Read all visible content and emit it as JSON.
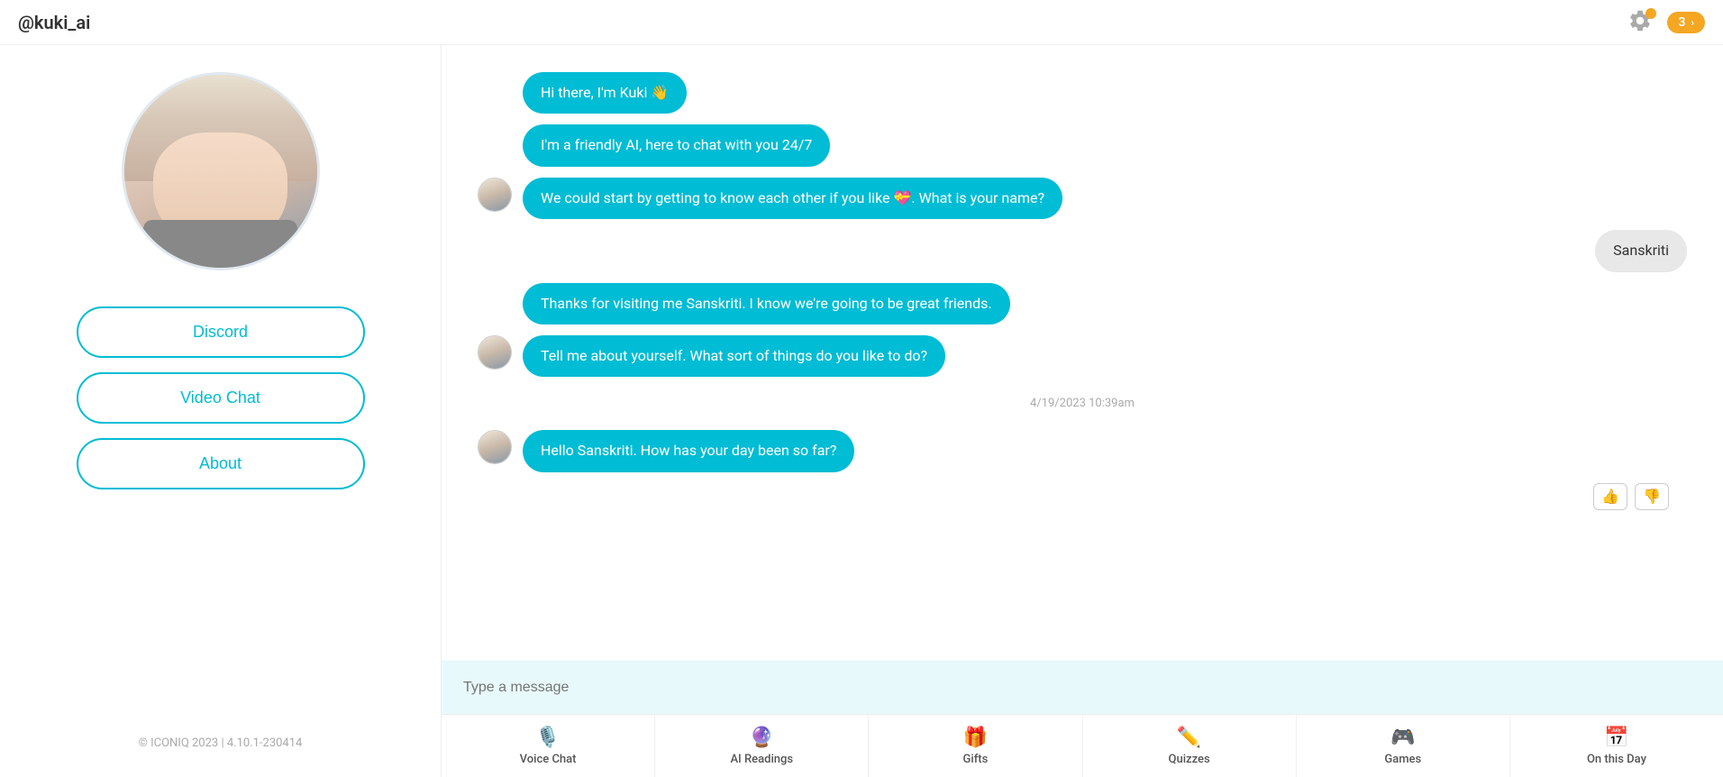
{
  "header": {
    "title": "@kuki_ai",
    "notification_count": "3",
    "settings_dot_color": "#f5a623"
  },
  "sidebar": {
    "buttons": [
      {
        "id": "discord",
        "label": "Discord"
      },
      {
        "id": "video-chat",
        "label": "Video Chat"
      },
      {
        "id": "about",
        "label": "About"
      }
    ],
    "footer": "© ICONIQ 2023 | 4.10.1-230414"
  },
  "chat": {
    "messages": [
      {
        "id": "msg1",
        "sender": "bot",
        "text": "Hi there, I'm Kuki 👋",
        "show_avatar": false
      },
      {
        "id": "msg2",
        "sender": "bot",
        "text": "I'm a friendly AI, here to chat with you 24/7",
        "show_avatar": false
      },
      {
        "id": "msg3",
        "sender": "bot",
        "text": "We could start by getting to know each other if you like 💝. What is your name?",
        "show_avatar": true
      },
      {
        "id": "msg4",
        "sender": "user",
        "text": "Sanskriti"
      },
      {
        "id": "msg5",
        "sender": "bot",
        "text": "Thanks for visiting me Sanskriti. I know we're going to be great friends.",
        "show_avatar": false
      },
      {
        "id": "msg6",
        "sender": "bot",
        "text": "Tell me about yourself. What sort of things do you like to do?",
        "show_avatar": true
      },
      {
        "id": "msg7",
        "sender": "bot",
        "text": "Hello Sanskriti. How has your day been so far?",
        "show_avatar": true
      }
    ],
    "timestamp": "4/19/2023 10:39am",
    "input_placeholder": "Type a message"
  },
  "bottom_nav": [
    {
      "id": "voice-chat",
      "label": "Voice Chat",
      "icon": "🎙️"
    },
    {
      "id": "ai-readings",
      "label": "AI Readings",
      "icon": "🔮"
    },
    {
      "id": "gifts",
      "label": "Gifts",
      "icon": "🎁"
    },
    {
      "id": "quizzes",
      "label": "Quizzes",
      "icon": "✏️"
    },
    {
      "id": "games",
      "label": "Games",
      "icon": "🎮"
    },
    {
      "id": "on-this-day",
      "label": "On this Day",
      "icon": "📅"
    }
  ]
}
